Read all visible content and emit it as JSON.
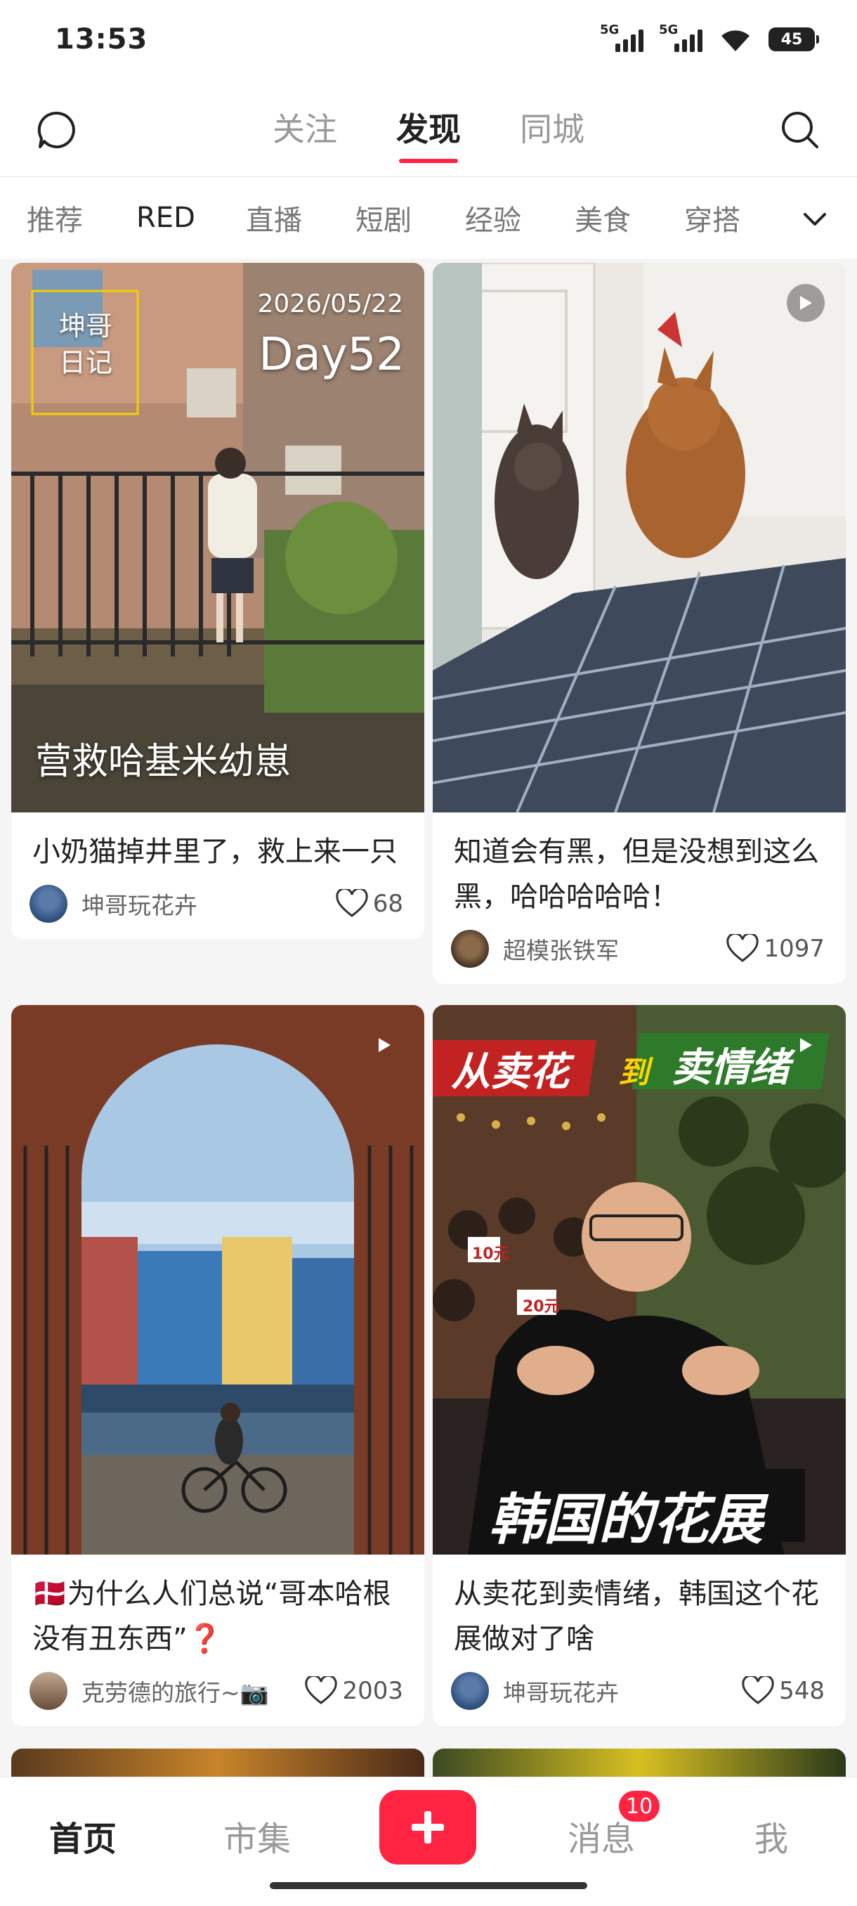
{
  "status_bar": {
    "time": "13:53",
    "signal1": "5G",
    "signal2": "5G",
    "battery": "45"
  },
  "top_nav": {
    "tabs": [
      "关注",
      "发现",
      "同城"
    ],
    "active_tab": "发现"
  },
  "categories": [
    "推荐",
    "RED",
    "直播",
    "短剧",
    "经验",
    "美食",
    "穿搭"
  ],
  "cards": [
    {
      "overlay_brand_line1": "坤哥",
      "overlay_brand_line2": "日记",
      "overlay_date": "2026/05/22",
      "overlay_day": "Day52",
      "overlay_caption": "营救哈基米幼崽",
      "title": "小奶猫掉井里了，救上来一只",
      "author": "坤哥玩花卉",
      "likes": "68"
    },
    {
      "title": "知道会有黑，但是没想到这么黑，哈哈哈哈哈！",
      "author": "超模张铁军",
      "likes": "1097"
    },
    {
      "title": "🇩🇰为什么人们总说“哥本哈根没有丑东西”❓",
      "author": "克劳德的旅行~📷",
      "likes": "2003"
    },
    {
      "overlay_top_left": "从卖花",
      "overlay_top_mid": "到",
      "overlay_top_right": "卖情绪",
      "overlay_price1": "10元",
      "overlay_price2": "20元",
      "overlay_bottom": "韩国的花展",
      "title": "从卖花到卖情绪，韩国这个花展做对了啥",
      "author": "坤哥玩花卉",
      "likes": "548"
    }
  ],
  "bottom_nav": {
    "home": "首页",
    "market": "市集",
    "messages": "消息",
    "me": "我",
    "badge": "10"
  },
  "colors": {
    "accent": "#ff2442"
  }
}
